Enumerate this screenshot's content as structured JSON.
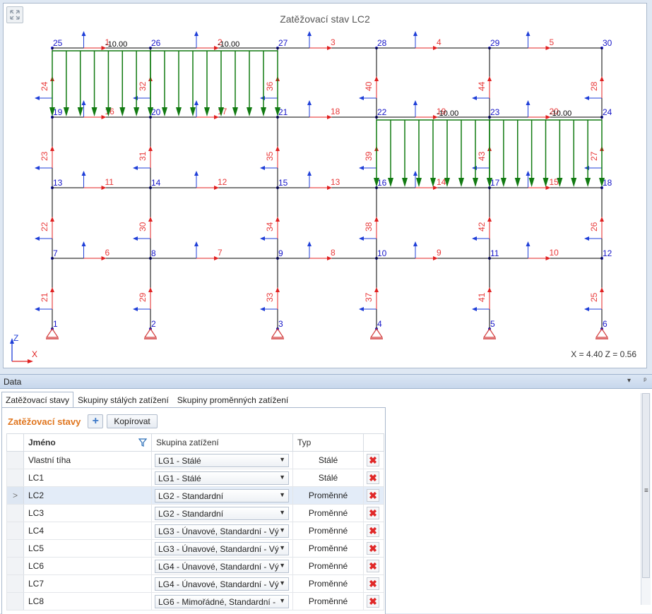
{
  "viewport": {
    "title": "Zatěžovací stav LC2",
    "coords": "X = 4.40  Z = 0.56",
    "axis_x": "X",
    "axis_z": "Z",
    "load_value": "-10.00",
    "colors": {
      "member": "#000000",
      "node_label": "#1515c8",
      "member_label": "#e83a3a",
      "load": "#117a11",
      "local_axis_z": "#1f3fd8",
      "local_axis_x": "#e02020",
      "support": "#d23c3c"
    }
  },
  "panel": {
    "title": "Data",
    "tabs": [
      "Zatěžovací stavy",
      "Skupiny stálých zatížení",
      "Skupiny proměnných zatížení"
    ],
    "section_title": "Zatěžovací stavy",
    "copy_label": "Kopírovat",
    "columns": {
      "name": "Jméno",
      "group": "Skupina zatížení",
      "type": "Typ"
    },
    "rows": [
      {
        "name": "Vlastní tíha",
        "group": "LG1 - Stálé",
        "type": "Stálé"
      },
      {
        "name": "LC1",
        "group": "LG1 - Stálé",
        "type": "Stálé"
      },
      {
        "name": "LC2",
        "group": "LG2 - Standardní",
        "type": "Proměnné",
        "current": true
      },
      {
        "name": "LC3",
        "group": "LG2 - Standardní",
        "type": "Proměnné"
      },
      {
        "name": "LC4",
        "group": "LG3 - Únavové, Standardní - Vý",
        "type": "Proměnné"
      },
      {
        "name": "LC5",
        "group": "LG3 - Únavové, Standardní - Vý",
        "type": "Proměnné"
      },
      {
        "name": "LC6",
        "group": "LG4 - Únavové, Standardní - Vý",
        "type": "Proměnné"
      },
      {
        "name": "LC7",
        "group": "LG4 - Únavové, Standardní - Vý",
        "type": "Proměnné"
      },
      {
        "name": "LC8",
        "group": "LG6 - Mimořádné, Standardní -",
        "type": "Proměnné"
      }
    ]
  }
}
